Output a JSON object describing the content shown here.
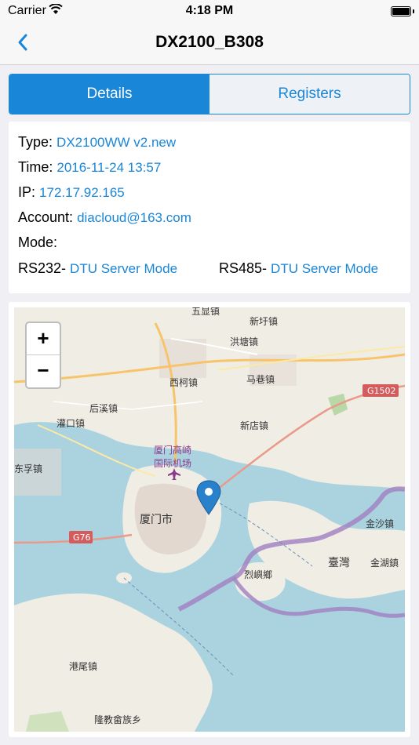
{
  "status_bar": {
    "carrier": "Carrier",
    "time": "4:18 PM"
  },
  "nav": {
    "back_icon": "chevron-left-icon",
    "title": "DX2100_B308"
  },
  "tabs": [
    {
      "label": "Details",
      "active": true
    },
    {
      "label": "Registers",
      "active": false
    }
  ],
  "details": {
    "type_label": "Type:",
    "type_value": "DX2100WW v2.new",
    "time_label": "Time:",
    "time_value": "2016-11-24 13:57",
    "ip_label": "IP:",
    "ip_value": "172.17.92.165",
    "account_label": "Account:",
    "account_value": "diacloud@163.com",
    "mode_label": "Mode:",
    "rs232_label": "RS232-",
    "rs232_value": "DTU Server Mode",
    "rs485_label": "RS485-",
    "rs485_value": "DTU Server Mode"
  },
  "map": {
    "zoom_in": "+",
    "zoom_out": "−",
    "labels": {
      "wuxian": "五显镇",
      "xinxu": "新圩镇",
      "hongtang": "洪塘镇",
      "xike": "西柯镇",
      "maxiang": "马巷镇",
      "houxi": "后溪镇",
      "guankou": "灌口镇",
      "xindian": "新店镇",
      "airport1": "厦门高崎",
      "airport2": "国际机场",
      "xiamen": "厦门市",
      "jinsha": "金沙镇",
      "taiwan": "臺灣",
      "jinhu": "金湖鎮",
      "lieyu": "烈嶼鄉",
      "gangwei": "港尾镇",
      "longhai": "隆教畲族乡",
      "dongfu": "东孚镇",
      "g1502": "G1502",
      "g76": "G76"
    }
  },
  "colors": {
    "accent": "#1a86d8",
    "sea": "#aad3df",
    "land": "#f0ede4"
  }
}
